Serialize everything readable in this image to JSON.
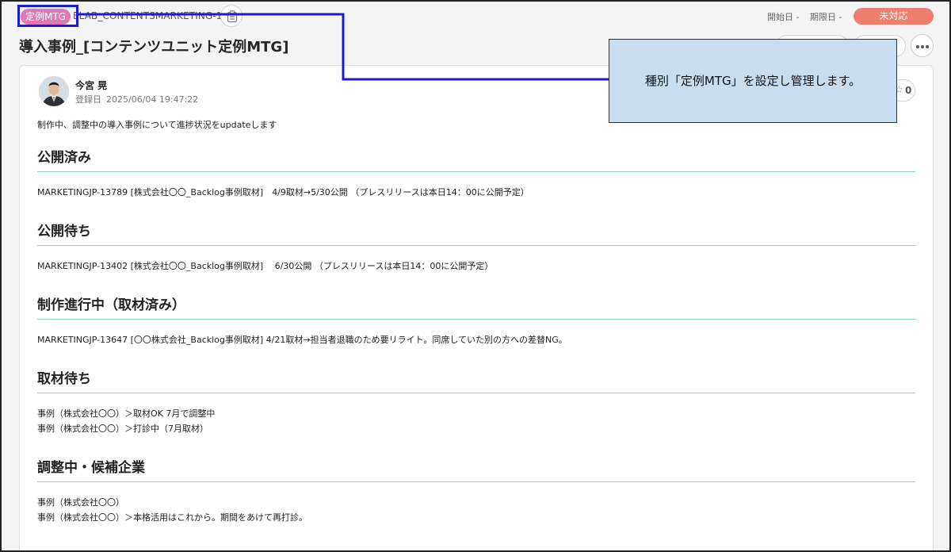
{
  "header": {
    "type_label": "定例MTG",
    "issue_key": "ELAB_CONTENTSMARKETING-11",
    "start_date_label": "開始日 -",
    "due_date_label": "期限日 -",
    "status": "未対応",
    "title": "導入事例_[コンテンツユニット定例MTG]"
  },
  "comment": {
    "author": "今宮 晃",
    "created_label": "登録日",
    "created_at": "2025/06/04 19:47:22",
    "star_count": "0",
    "intro": "制作中、調整中の導入事例について進捗状況をupdateします"
  },
  "sections": [
    {
      "heading": "公開済み",
      "lines": [
        "MARKETINGJP-13789 [株式会社〇〇_Backlog事例取材]　4/9取材→5/30公開 （プレスリリースは本日14：00に公開予定）"
      ]
    },
    {
      "heading": "公開待ち",
      "lines": [
        "MARKETINGJP-13402 [株式会社〇〇_Backlog事例取材]　 6/30公開 （プレスリリースは本日14：00に公開予定）"
      ]
    },
    {
      "heading": "制作進行中（取材済み）",
      "lines": [
        "MARKETINGJP-13647 [〇〇株式会社_Backlog事例取材] 4/21取材→担当者退職のため要リライト。同席していた別の方への差替NG。"
      ]
    },
    {
      "heading": "取材待ち",
      "lines": [
        "事例（株式会社〇〇）＞取材OK 7月で調整中",
        "事例（株式会社〇〇）＞打診中（7月取材）"
      ]
    },
    {
      "heading": "調整中・候補企業",
      "lines": [
        "事例（株式会社〇〇）",
        "事例（株式会社〇〇）＞本格活用はこれから。期間をあけて再打診。"
      ]
    }
  ],
  "callout": {
    "text": "種別「定例MTG」を設定し管理します。"
  },
  "colors": {
    "type_badge": "#e078b7",
    "status_pill": "#ee7f6f",
    "section_rule": "#8fcfb8",
    "highlight": "#1b1bd6",
    "callout_bg": "#c9ddf0"
  }
}
